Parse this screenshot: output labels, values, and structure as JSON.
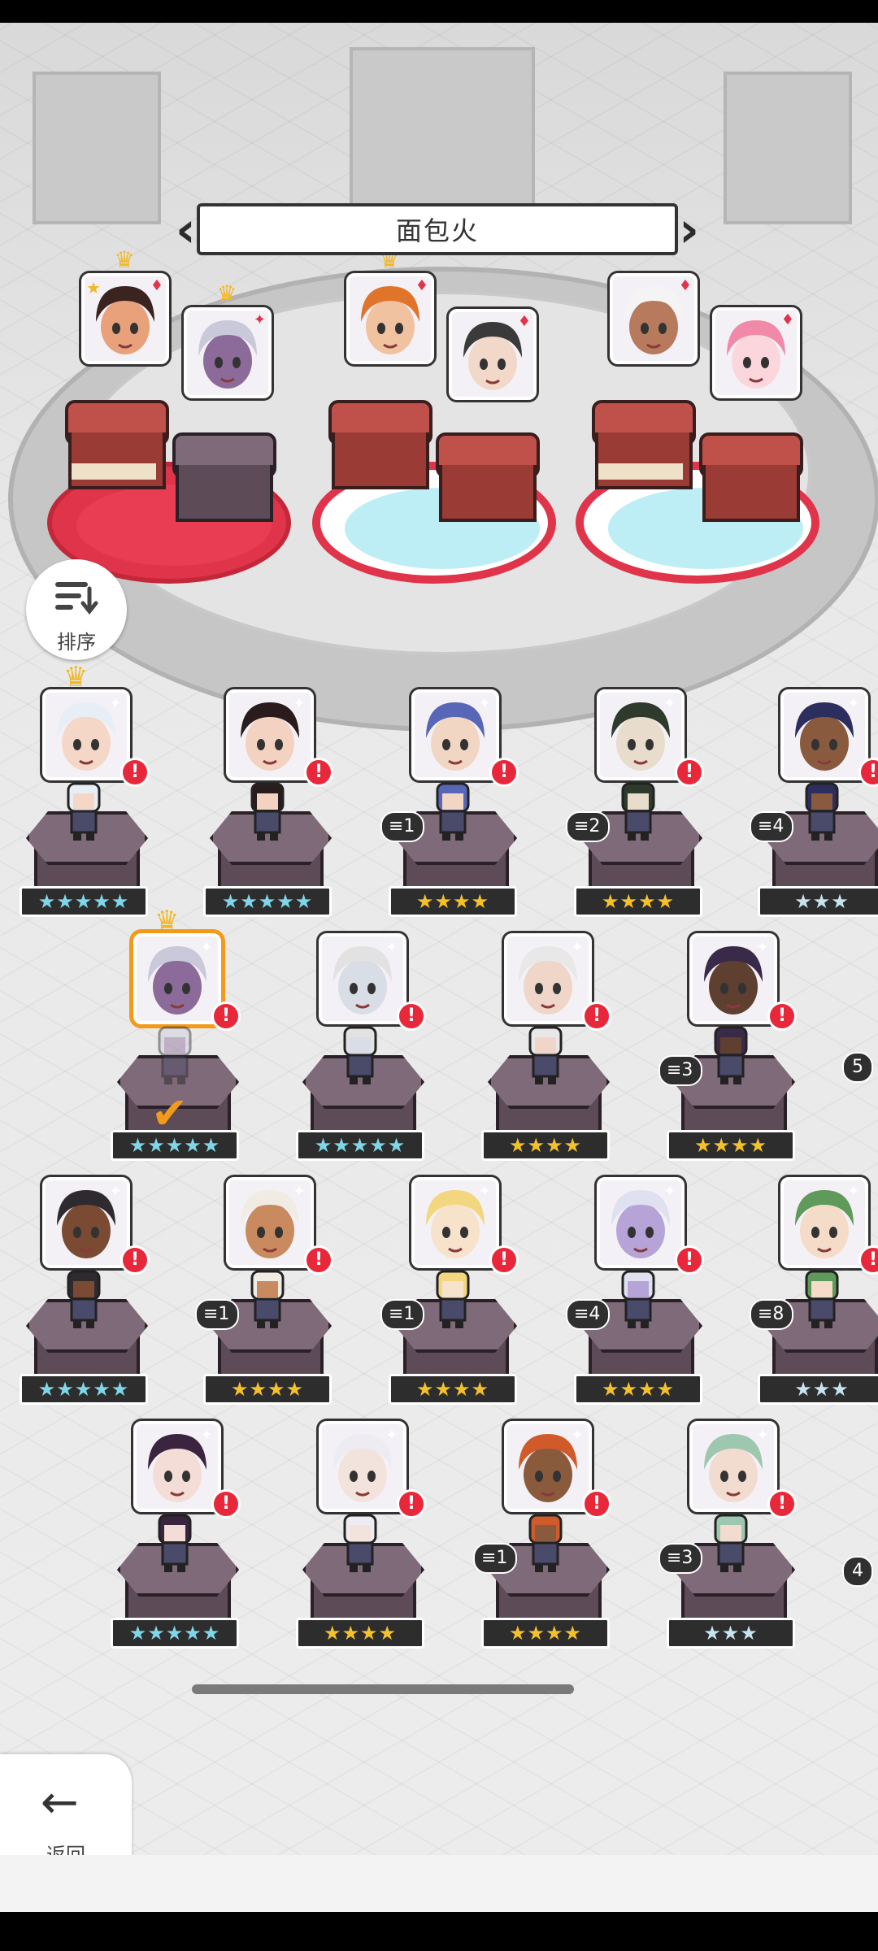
{
  "title": "面包火",
  "sort_label": "排序",
  "back_label": "返回",
  "team": [
    {
      "id": "t1",
      "suit": "♦",
      "color": "#e8a17a",
      "hair": "#3b2320",
      "crown": true,
      "starred": true
    },
    {
      "id": "t2",
      "suit": "✦",
      "color": "#8c6b9a",
      "hair": "#c9c9d9",
      "crown": true
    },
    {
      "id": "t3",
      "suit": "♦",
      "color": "#f0c2a0",
      "hair": "#e0742a",
      "crown": true
    },
    {
      "id": "t4",
      "suit": "♦",
      "color": "#f2d8c8",
      "hair": "#3a3a3a"
    },
    {
      "id": "t5",
      "suit": "♦",
      "color": "#b77a5d",
      "hair": "#f4f4f4"
    },
    {
      "id": "t6",
      "suit": "♦",
      "color": "#fbd6dd",
      "hair": "#f08aa8"
    }
  ],
  "roster": [
    {
      "stars": "★★★★★",
      "tier": "blue",
      "dup": "",
      "hair": "#e8eef5",
      "skin": "#f5d7c7",
      "crown": true
    },
    {
      "stars": "★★★★★",
      "tier": "blue",
      "dup": "",
      "hair": "#2a1c1c",
      "skin": "#f4d2c2"
    },
    {
      "stars": "★★★★",
      "tier": "gold",
      "dup": "1",
      "hair": "#5866b8",
      "skin": "#f2d6c4"
    },
    {
      "stars": "★★★★",
      "tier": "gold",
      "dup": "2",
      "hair": "#2e3a2c",
      "skin": "#e8dccd"
    },
    {
      "stars": "★★★",
      "tier": "pale",
      "dup": "4",
      "hair": "#2c2f5e",
      "skin": "#8a5a3f"
    },
    {
      "stars": "★★★★★",
      "tier": "blue",
      "dup": "",
      "hair": "#c9c9d9",
      "skin": "#8c6b9a",
      "crown": true,
      "selected": true
    },
    {
      "stars": "★★★★★",
      "tier": "blue",
      "dup": "",
      "hair": "#e2e2e2",
      "skin": "#d9dde6"
    },
    {
      "stars": "★★★★",
      "tier": "gold",
      "dup": "",
      "hair": "#e8e8e8",
      "skin": "#f0d6c8"
    },
    {
      "stars": "★★★★",
      "tier": "gold",
      "dup": "3",
      "hair": "#3a2a4a",
      "skin": "#5e3f30"
    },
    {
      "stars": "★★★★★",
      "tier": "blue",
      "dup": "",
      "hair": "#2e2a30",
      "skin": "#7a4a33"
    },
    {
      "stars": "★★★★",
      "tier": "gold",
      "dup": "1",
      "hair": "#f0ece4",
      "skin": "#c88a5e"
    },
    {
      "stars": "★★★★",
      "tier": "gold",
      "dup": "1",
      "hair": "#f3d680",
      "skin": "#f7e2cc"
    },
    {
      "stars": "★★★★",
      "tier": "gold",
      "dup": "4",
      "hair": "#dfe0f0",
      "skin": "#b6a3d8"
    },
    {
      "stars": "★★★",
      "tier": "pale",
      "dup": "8",
      "hair": "#5f9a5a",
      "skin": "#f5dcc8"
    },
    {
      "stars": "★★★★★",
      "tier": "blue",
      "dup": "",
      "hair": "#3a2440",
      "skin": "#f4ddd6"
    },
    {
      "stars": "★★★★",
      "tier": "gold",
      "dup": "",
      "hair": "#ececf2",
      "skin": "#f2e4dc"
    },
    {
      "stars": "★★★★",
      "tier": "gold",
      "dup": "1",
      "hair": "#d05a2a",
      "skin": "#8a5a3c"
    },
    {
      "stars": "★★★",
      "tier": "pale",
      "dup": "3",
      "hair": "#9ec7b0",
      "skin": "#f2dcd0"
    }
  ],
  "partial_dups": [
    "5",
    "4"
  ]
}
